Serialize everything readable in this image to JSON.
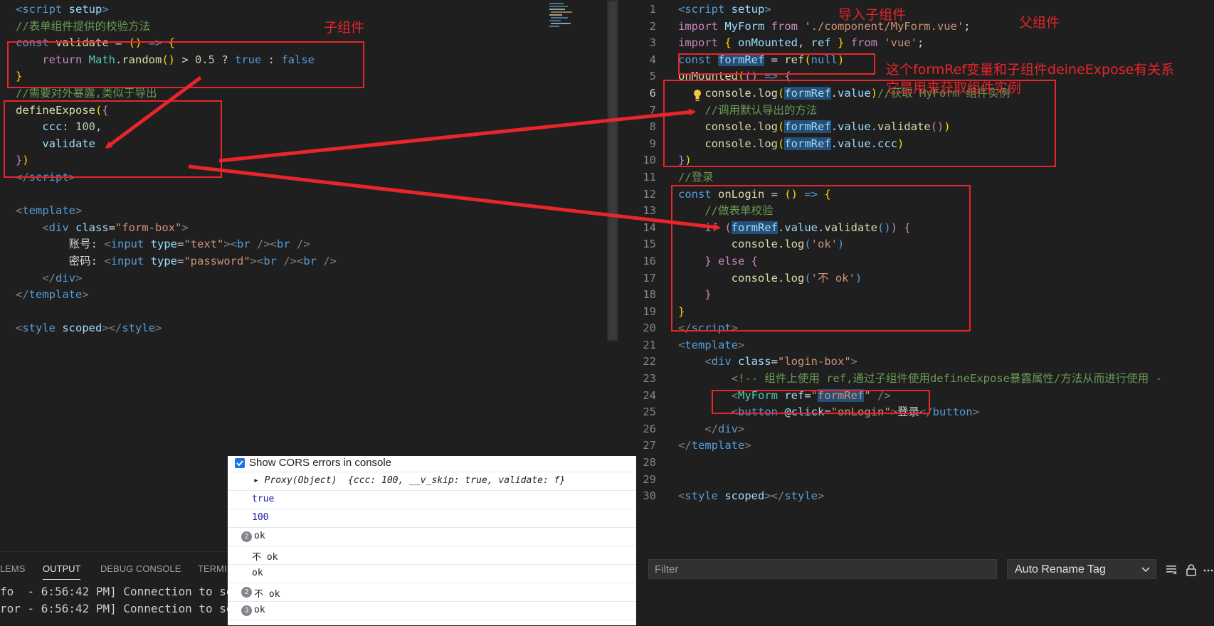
{
  "left_editor": {
    "lines": [
      [
        [
          "t",
          "<script "
        ],
        [
          "a",
          "setup"
        ],
        [
          "t",
          ">"
        ]
      ],
      [
        [
          "c",
          "//表单组件提供的校验方法"
        ]
      ],
      [
        [
          "k",
          "const "
        ],
        [
          "f",
          "validate"
        ],
        [
          "d",
          " = "
        ],
        [
          "y",
          "()"
        ],
        [
          "k",
          " => "
        ],
        [
          "y",
          "{"
        ]
      ],
      [
        [
          "d",
          "    "
        ],
        [
          "ctl",
          "return "
        ],
        [
          "cmp",
          "Math"
        ],
        [
          "d",
          "."
        ],
        [
          "f",
          "random"
        ],
        [
          "y",
          "()"
        ],
        [
          "d",
          " > "
        ],
        [
          "n",
          "0.5"
        ],
        [
          "d",
          " ? "
        ],
        [
          "k",
          "true"
        ],
        [
          "d",
          " : "
        ],
        [
          "k",
          "false"
        ]
      ],
      [
        [
          "y",
          "}"
        ]
      ],
      [
        [
          "c",
          "//需要对外暴露,类似于导出"
        ]
      ],
      [
        [
          "f",
          "defineExpose"
        ],
        [
          "y",
          "("
        ],
        [
          "ctl",
          "{"
        ]
      ],
      [
        [
          "d",
          "    "
        ],
        [
          "v",
          "ccc"
        ],
        [
          "d",
          ": "
        ],
        [
          "n",
          "100"
        ],
        [
          "d",
          ","
        ]
      ],
      [
        [
          "d",
          "    "
        ],
        [
          "v",
          "validate"
        ]
      ],
      [
        [
          "ctl",
          "}"
        ],
        [
          "y",
          ")"
        ]
      ],
      [
        [
          "p",
          "</"
        ],
        [
          "t",
          "script"
        ],
        [
          "p",
          ">"
        ]
      ],
      [],
      [
        [
          "p",
          "<"
        ],
        [
          "t",
          "template"
        ],
        [
          "p",
          ">"
        ]
      ],
      [
        [
          "d",
          "    "
        ],
        [
          "p",
          "<"
        ],
        [
          "t",
          "div "
        ],
        [
          "a",
          "class"
        ],
        [
          "d",
          "="
        ],
        [
          "s",
          "\"form-box\""
        ],
        [
          "p",
          ">"
        ]
      ],
      [
        [
          "d",
          "        账号: "
        ],
        [
          "p",
          "<"
        ],
        [
          "t",
          "input "
        ],
        [
          "a",
          "type"
        ],
        [
          "d",
          "="
        ],
        [
          "s",
          "\"text\""
        ],
        [
          "p",
          "><"
        ],
        [
          "t",
          "br "
        ],
        [
          "p",
          "/><"
        ],
        [
          "t",
          "br "
        ],
        [
          "p",
          "/>"
        ]
      ],
      [
        [
          "d",
          "        密码: "
        ],
        [
          "p",
          "<"
        ],
        [
          "t",
          "input "
        ],
        [
          "a",
          "type"
        ],
        [
          "d",
          "="
        ],
        [
          "s",
          "\"password\""
        ],
        [
          "p",
          "><"
        ],
        [
          "t",
          "br "
        ],
        [
          "p",
          "/><"
        ],
        [
          "t",
          "br "
        ],
        [
          "p",
          "/>"
        ]
      ],
      [
        [
          "d",
          "    "
        ],
        [
          "p",
          "</"
        ],
        [
          "t",
          "div"
        ],
        [
          "p",
          ">"
        ]
      ],
      [
        [
          "p",
          "</"
        ],
        [
          "t",
          "template"
        ],
        [
          "p",
          ">"
        ]
      ],
      [],
      [
        [
          "p",
          "<"
        ],
        [
          "t",
          "style "
        ],
        [
          "a",
          "scoped"
        ],
        [
          "p",
          "></"
        ],
        [
          "t",
          "style"
        ],
        [
          "p",
          ">"
        ]
      ]
    ]
  },
  "right_editor": {
    "active_line": 6,
    "lines": [
      [
        [
          "t",
          "<script "
        ],
        [
          "a",
          "setup"
        ],
        [
          "t",
          ">"
        ]
      ],
      [
        [
          "ctl",
          "import "
        ],
        [
          "v",
          "MyForm "
        ],
        [
          "ctl",
          "from "
        ],
        [
          "s",
          "'./component/MyForm.vue'"
        ],
        [
          "d",
          ";"
        ]
      ],
      [
        [
          "ctl",
          "import "
        ],
        [
          "y",
          "{ "
        ],
        [
          "v",
          "onMounted"
        ],
        [
          "d",
          ", "
        ],
        [
          "v",
          "ref "
        ],
        [
          "y",
          "}"
        ],
        [
          "ctl",
          " from "
        ],
        [
          "s",
          "'vue'"
        ],
        [
          "d",
          ";"
        ]
      ],
      [
        [
          "k",
          "const "
        ],
        [
          "hl",
          "formRef"
        ],
        [
          "d",
          " = "
        ],
        [
          "f",
          "ref"
        ],
        [
          "y",
          "("
        ],
        [
          "k",
          "null"
        ],
        [
          "y",
          ")"
        ]
      ],
      [
        [
          "f",
          "onMounted"
        ],
        [
          "y",
          "("
        ],
        [
          "ctl",
          "()"
        ],
        [
          "k",
          " => "
        ],
        [
          "ctl",
          "{"
        ]
      ],
      [
        [
          "d",
          "    "
        ],
        [
          "f",
          "console"
        ],
        [
          "d",
          "."
        ],
        [
          "f",
          "log"
        ],
        [
          "y",
          "("
        ],
        [
          "hl",
          "formRef"
        ],
        [
          "d",
          "."
        ],
        [
          "v",
          "value"
        ],
        [
          "y",
          ")"
        ],
        [
          "c",
          "//获取 MyForm 组件实例"
        ]
      ],
      [
        [
          "d",
          "    "
        ],
        [
          "c",
          "//调用默认导出的方法"
        ]
      ],
      [
        [
          "d",
          "    "
        ],
        [
          "f",
          "console"
        ],
        [
          "d",
          "."
        ],
        [
          "f",
          "log"
        ],
        [
          "y",
          "("
        ],
        [
          "hl",
          "formRef"
        ],
        [
          "d",
          "."
        ],
        [
          "v",
          "value"
        ],
        [
          "d",
          "."
        ],
        [
          "f",
          "validate"
        ],
        [
          "ctl",
          "()"
        ],
        [
          "y",
          ")"
        ]
      ],
      [
        [
          "d",
          "    "
        ],
        [
          "f",
          "console"
        ],
        [
          "d",
          "."
        ],
        [
          "f",
          "log"
        ],
        [
          "y",
          "("
        ],
        [
          "hl",
          "formRef"
        ],
        [
          "d",
          "."
        ],
        [
          "v",
          "value"
        ],
        [
          "d",
          "."
        ],
        [
          "v",
          "ccc"
        ],
        [
          "y",
          ")"
        ]
      ],
      [
        [
          "ctl",
          "}"
        ],
        [
          "y",
          ")"
        ]
      ],
      [
        [
          "c",
          "//登录"
        ]
      ],
      [
        [
          "k",
          "const "
        ],
        [
          "f",
          "onLogin"
        ],
        [
          "d",
          " = "
        ],
        [
          "y",
          "()"
        ],
        [
          "k",
          " => "
        ],
        [
          "y",
          "{"
        ]
      ],
      [
        [
          "d",
          "    "
        ],
        [
          "c",
          "//做表单校验"
        ]
      ],
      [
        [
          "d",
          "    "
        ],
        [
          "ctl",
          "if "
        ],
        [
          "ctl",
          "("
        ],
        [
          "hl",
          "formRef"
        ],
        [
          "d",
          "."
        ],
        [
          "v",
          "value"
        ],
        [
          "d",
          "."
        ],
        [
          "f",
          "validate"
        ],
        [
          "k",
          "()"
        ],
        [
          "ctl",
          ")"
        ],
        [
          "ctl",
          " {"
        ]
      ],
      [
        [
          "d",
          "        "
        ],
        [
          "f",
          "console"
        ],
        [
          "d",
          "."
        ],
        [
          "f",
          "log"
        ],
        [
          "k",
          "("
        ],
        [
          "s",
          "'ok'"
        ],
        [
          "k",
          ")"
        ]
      ],
      [
        [
          "d",
          "    "
        ],
        [
          "ctl",
          "} "
        ],
        [
          "ctl",
          "else "
        ],
        [
          "ctl",
          "{"
        ]
      ],
      [
        [
          "d",
          "        "
        ],
        [
          "f",
          "console"
        ],
        [
          "d",
          "."
        ],
        [
          "f",
          "log"
        ],
        [
          "k",
          "("
        ],
        [
          "s",
          "'不 ok'"
        ],
        [
          "k",
          ")"
        ]
      ],
      [
        [
          "d",
          "    "
        ],
        [
          "ctl",
          "}"
        ]
      ],
      [
        [
          "y",
          "}"
        ]
      ],
      [
        [
          "p",
          "</"
        ],
        [
          "t",
          "script"
        ],
        [
          "p",
          ">"
        ]
      ],
      [
        [
          "p",
          "<"
        ],
        [
          "t",
          "template"
        ],
        [
          "p",
          ">"
        ]
      ],
      [
        [
          "d",
          "    "
        ],
        [
          "p",
          "<"
        ],
        [
          "t",
          "div "
        ],
        [
          "a",
          "class"
        ],
        [
          "d",
          "="
        ],
        [
          "s",
          "\"login-box\""
        ],
        [
          "p",
          ">"
        ]
      ],
      [
        [
          "d",
          "        "
        ],
        [
          "c",
          "<!-- 组件上使用 ref,通过子组件使用defineExpose暴露属性/方法从而进行使用 -"
        ]
      ],
      [
        [
          "d",
          "        "
        ],
        [
          "p",
          "<"
        ],
        [
          "cmp",
          "MyForm "
        ],
        [
          "a",
          "ref"
        ],
        [
          "d",
          "="
        ],
        [
          "s",
          "\""
        ],
        [
          "hl2",
          "formRef"
        ],
        [
          "s",
          "\""
        ],
        [
          "p",
          " />"
        ]
      ],
      [
        [
          "d",
          "        "
        ],
        [
          "p",
          "<"
        ],
        [
          "t",
          "button "
        ],
        [
          "a",
          "@click"
        ],
        [
          "d",
          "="
        ],
        [
          "s",
          "\"onLogin\""
        ],
        [
          "p",
          ">"
        ],
        [
          "d",
          "登录"
        ],
        [
          "p",
          "</"
        ],
        [
          "t",
          "button"
        ],
        [
          "p",
          ">"
        ]
      ],
      [
        [
          "d",
          "    "
        ],
        [
          "p",
          "</"
        ],
        [
          "t",
          "div"
        ],
        [
          "p",
          ">"
        ]
      ],
      [
        [
          "p",
          "</"
        ],
        [
          "t",
          "template"
        ],
        [
          "p",
          ">"
        ]
      ],
      [],
      [],
      [
        [
          "p",
          "<"
        ],
        [
          "t",
          "style "
        ],
        [
          "a",
          "scoped"
        ],
        [
          "p",
          "></"
        ],
        [
          "t",
          "style"
        ],
        [
          "p",
          ">"
        ]
      ]
    ]
  },
  "annotations": {
    "child_component": "子组件",
    "import_child": "导入子组件",
    "parent_component": "父组件",
    "formref_relation": "这个formRef变量和子组件deineExpose有关系",
    "formref_purpose": "它是用来获取组件实例"
  },
  "bottom_panel": {
    "tabs": [
      "LEMS",
      "OUTPUT",
      "DEBUG CONSOLE",
      "TERMI"
    ],
    "active_tab": "OUTPUT",
    "output_lines": [
      "fo  - 6:56:42 PM] Connection to se",
      "ror - 6:56:42 PM] Connection to se"
    ]
  },
  "output_toolbar": {
    "filter_placeholder": "Filter",
    "selected_channel": "Auto Rename Tag"
  },
  "devtools_console": {
    "cors_label": "Show CORS errors in console",
    "rows": [
      {
        "badge": "",
        "text": "▸ Proxy(Object)  {ccc: 100, __v_skip: true, validate: f}",
        "kind": "object"
      },
      {
        "badge": "",
        "text": "true",
        "kind": "bool"
      },
      {
        "badge": "",
        "text": "100",
        "kind": "num"
      },
      {
        "badge": "2",
        "text": "ok",
        "kind": "str"
      },
      {
        "badge": "",
        "text": "不 ok",
        "kind": "str"
      },
      {
        "badge": "",
        "text": "ok",
        "kind": "str"
      },
      {
        "badge": "2",
        "text": "不 ok",
        "kind": "str"
      },
      {
        "badge": "3",
        "text": "ok",
        "kind": "str"
      }
    ]
  }
}
